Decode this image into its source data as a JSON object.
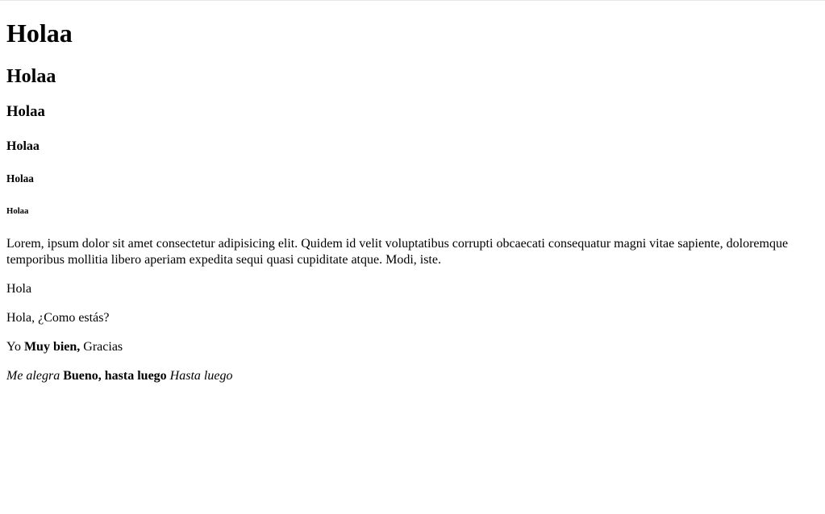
{
  "headings": {
    "h1": "Holaa",
    "h2": "Holaa",
    "h3": "Holaa",
    "h4": "Holaa",
    "h5": "Holaa",
    "h6": "Holaa"
  },
  "paragraphs": {
    "lorem": "Lorem, ipsum dolor sit amet consectetur adipisicing elit. Quidem id velit voluptatibus corrupti obcaecati consequatur magni vitae sapiente, doloremque temporibus mollitia libero aperiam expedita sequi quasi cupiditate atque. Modi, iste.",
    "hola": "Hola",
    "como": "Hola, ¿Como estás?",
    "yo": {
      "prefix": "Yo",
      "bold": "Muy bien,",
      "suffix": "Gracias"
    },
    "alegra": {
      "italic1": "Me alegra",
      "bold": "Bueno, hasta luego",
      "italic2": "Hasta luego"
    }
  }
}
